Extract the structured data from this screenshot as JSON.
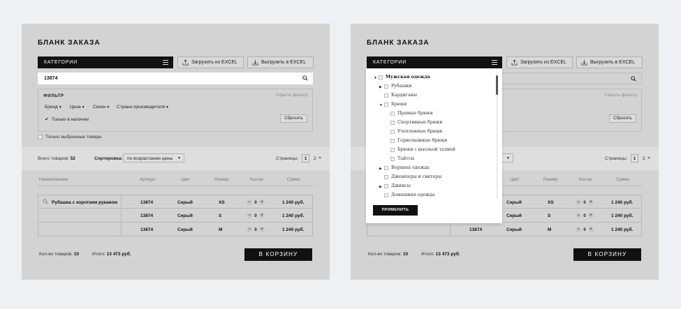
{
  "left": {
    "title": "БЛАНК ЗАКАЗА",
    "categories_label": "КАТЕГОРИИ",
    "upload_excel": "Загрузить из EXCEL",
    "download_excel": "Выгрузить в EXCEL",
    "search_value": "13874",
    "filter_title": "ФИЛЬТР",
    "hide_filter": "Скрыть фильтр",
    "filter_brand": "Бренд",
    "filter_price": "Цена",
    "filter_season": "Сезон",
    "filter_country": "Страна производителя",
    "in_stock": "Только в наличии",
    "reset": "Сбросить",
    "only_selected": "Только выбранные товары",
    "total_label": "Всего товаров:",
    "total_value": "52",
    "sort_label": "Сортировка:",
    "sort_value": "по возрастанию цены",
    "pages_label": "Страницы:",
    "page1": "1",
    "page2": "2",
    "page_next": "»",
    "headers": {
      "name": "Наименование",
      "article": "Артикул",
      "color": "Цвет",
      "size": "Размер",
      "qty": "Кол-во",
      "sum": "Сумма"
    },
    "rows": [
      {
        "name": "Рубашка с коротким рукавом",
        "article": "13874",
        "color": "Серый",
        "size": "XS",
        "qty": "0",
        "sum": "1 240 руб."
      },
      {
        "name": "",
        "article": "13874",
        "color": "Серый",
        "size": "S",
        "qty": "0",
        "sum": "1 240 руб."
      },
      {
        "name": "",
        "article": "13874",
        "color": "Серый",
        "size": "M",
        "qty": "0",
        "sum": "1 240 руб."
      }
    ],
    "count_label": "Кол-во товаров:",
    "count_value": "10",
    "sum_label": "Итого:",
    "sum_value": "13 473 руб.",
    "cart": "В КОРЗИНУ"
  },
  "right": {
    "title": "БЛАНК ЗАКАЗА",
    "categories_label": "КАТЕГОРИИ",
    "upload_excel": "Загрузить из EXCEL",
    "download_excel": "Выгрузить в EXCEL",
    "hide_filter": "Скрыть фильтр",
    "reset": "Сбросить",
    "pages_label": "Страницы:",
    "page1": "1",
    "page2": "2",
    "page_next": "»",
    "headers": {
      "color": "Цвет",
      "size": "Размер",
      "qty": "Кол-во",
      "sum": "Сумма"
    },
    "rows": [
      {
        "article": "",
        "color": "Серый",
        "size": "XS",
        "qty": "0",
        "sum": "1 240 руб."
      },
      {
        "article": "",
        "color": "Серый",
        "size": "S",
        "qty": "0",
        "sum": "1 240 руб."
      },
      {
        "article": "13874",
        "color": "Серый",
        "size": "M",
        "qty": "0",
        "sum": "1 240 руб."
      }
    ],
    "count_label": "Кол-во товаров:",
    "count_value": "10",
    "sum_label": "Итого:",
    "sum_value": "13 473 руб.",
    "cart": "В КОРЗИНУ",
    "tree": [
      "Мужская одежда",
      "Рубашки",
      "Кардиганы",
      "Брюки",
      "Прямые брюки",
      "Спортивные брюки",
      "Утепленные брюки",
      "Горнолыжные брюки",
      "Брюки с высокой талией",
      "Тайтсы",
      "Верхняя одежда",
      "Джемперы и свитеры",
      "Джинсы",
      "Домашняя одежда"
    ],
    "apply": "ПРИМЕНИТЬ"
  },
  "colors": {
    "page_bg": "#eef0f4",
    "panel_bg": "#d3d3d3",
    "dark": "#111111"
  }
}
